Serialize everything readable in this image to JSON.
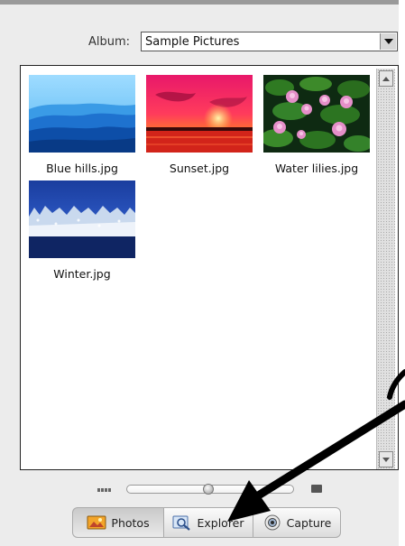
{
  "album": {
    "label": "Album:",
    "selected": "Sample Pictures"
  },
  "photos": [
    {
      "filename": "Blue hills.jpg"
    },
    {
      "filename": "Sunset.jpg"
    },
    {
      "filename": "Water lilies.jpg"
    },
    {
      "filename": "Winter.jpg"
    }
  ],
  "tabs": [
    {
      "label": "Photos",
      "icon": "photos-icon",
      "active": true
    },
    {
      "label": "Explorer",
      "icon": "explorer-icon",
      "active": false
    },
    {
      "label": "Capture",
      "icon": "capture-icon",
      "active": false
    }
  ],
  "zoom": {
    "level": 0.49
  },
  "colors": {
    "annotation_arrow": "#000000",
    "panel_background": "#ececec"
  }
}
